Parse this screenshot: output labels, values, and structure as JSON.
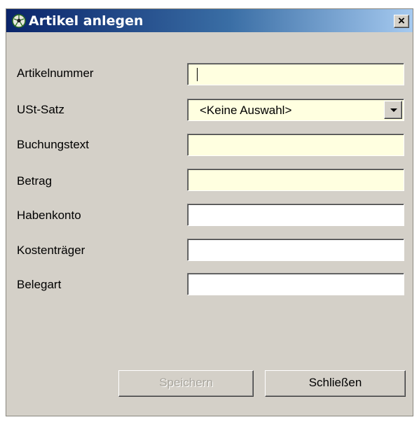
{
  "window": {
    "title": "Artikel anlegen",
    "close_label": "×"
  },
  "form": {
    "artikelnummer_label": "Artikelnummer",
    "artikelnummer_value": "",
    "ust_label": "USt-Satz",
    "ust_value": "<Keine Auswahl>",
    "buchungstext_label": "Buchungstext",
    "buchungstext_value": "",
    "betrag_label": "Betrag",
    "betrag_value": "",
    "habenkonto_label": "Habenkonto",
    "habenkonto_value": "",
    "kostentraeger_label": "Kostenträger",
    "kostentraeger_value": "",
    "belegart_label": "Belegart",
    "belegart_value": ""
  },
  "buttons": {
    "save_label": "Speichern",
    "close_label": "Schließen"
  },
  "colors": {
    "required_field": "#ffffe0",
    "dialog_face": "#d4d0c8",
    "titlebar_start": "#0a246a",
    "titlebar_end": "#a6caf0"
  }
}
